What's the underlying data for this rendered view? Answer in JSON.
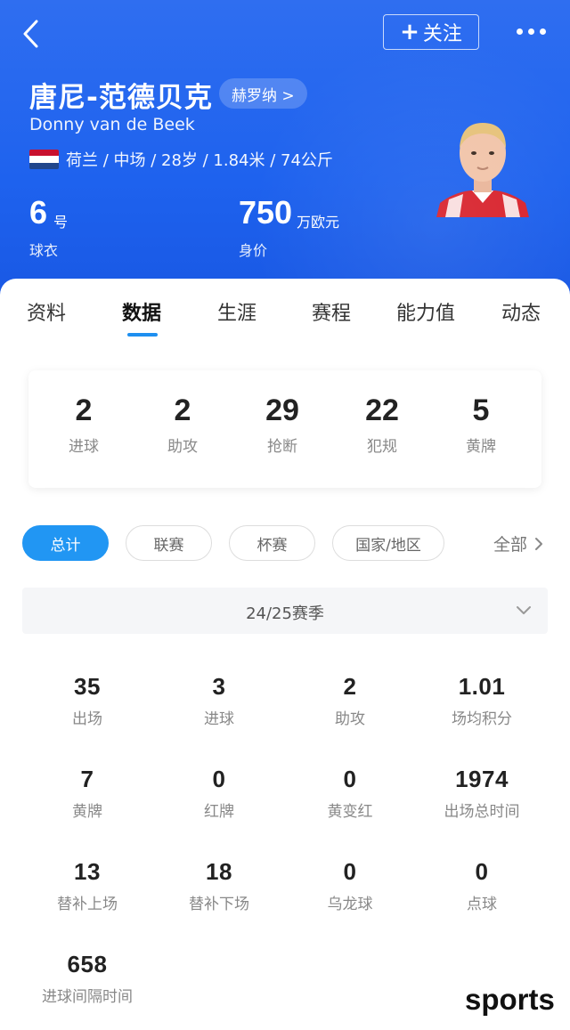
{
  "header": {
    "follow_label": "关注",
    "name_zh": "唐尼-范德贝克",
    "club_label": "赫罗纳 >",
    "name_en": "Donny van de Beek",
    "info": "荷兰 / 中场 / 28岁 / 1.84米 / 74公斤",
    "shirt_number": "6",
    "shirt_unit": "号",
    "shirt_label": "球衣",
    "market_value": "750",
    "market_unit": "万欧元",
    "market_label": "身价",
    "accent_color": "#1e62ee"
  },
  "tabs": [
    "资料",
    "数据",
    "生涯",
    "赛程",
    "能力值",
    "动态"
  ],
  "active_tab": "数据",
  "summary": [
    {
      "value": "2",
      "label": "进球"
    },
    {
      "value": "2",
      "label": "助攻"
    },
    {
      "value": "29",
      "label": "抢断"
    },
    {
      "value": "22",
      "label": "犯规"
    },
    {
      "value": "5",
      "label": "黄牌"
    }
  ],
  "filters": [
    "总计",
    "联赛",
    "杯赛",
    "国家/地区"
  ],
  "active_filter": "总计",
  "all_label": "全部",
  "season": "24/25赛季",
  "stats": [
    {
      "value": "35",
      "label": "出场"
    },
    {
      "value": "3",
      "label": "进球"
    },
    {
      "value": "2",
      "label": "助攻"
    },
    {
      "value": "1.01",
      "label": "场均积分"
    },
    {
      "value": "7",
      "label": "黄牌"
    },
    {
      "value": "0",
      "label": "红牌"
    },
    {
      "value": "0",
      "label": "黄变红"
    },
    {
      "value": "1974",
      "label": "出场总时间"
    },
    {
      "value": "13",
      "label": "替补上场"
    },
    {
      "value": "18",
      "label": "替补下场"
    },
    {
      "value": "0",
      "label": "乌龙球"
    },
    {
      "value": "0",
      "label": "点球"
    },
    {
      "value": "658",
      "label": "进球间隔时间"
    }
  ],
  "watermark": "sports"
}
